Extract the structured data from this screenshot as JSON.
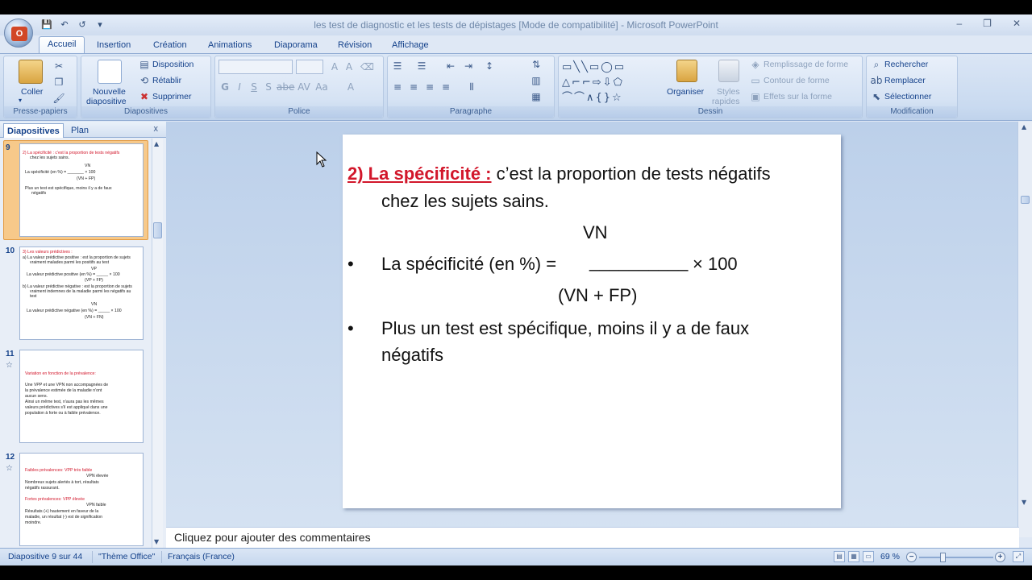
{
  "window": {
    "title": "les test de diagnostic et les tests de dépistages [Mode de compatibilité] - Microsoft PowerPoint",
    "controls": [
      "–",
      "❐",
      "✕"
    ]
  },
  "ribbon_tabs": [
    "Accueil",
    "Insertion",
    "Création",
    "Animations",
    "Diaporama",
    "Révision",
    "Affichage"
  ],
  "ribbon": {
    "clipboard": {
      "label": "Presse-papiers",
      "paste": "Coller"
    },
    "slides": {
      "label": "Diapositives",
      "new_slide_1": "Nouvelle",
      "new_slide_2": "diapositive",
      "layout": "Disposition",
      "reset": "Rétablir",
      "delete": "Supprimer"
    },
    "font": {
      "label": "Police"
    },
    "paragraph": {
      "label": "Paragraphe"
    },
    "drawing": {
      "label": "Dessin",
      "arrange": "Organiser",
      "quick_styles_1": "Styles",
      "quick_styles_2": "rapides",
      "fill": "Remplissage de forme",
      "outline": "Contour de forme",
      "effects": "Effets sur la forme"
    },
    "editing": {
      "label": "Modification",
      "find": "Rechercher",
      "replace": "Remplacer",
      "select": "Sélectionner"
    }
  },
  "left_panel": {
    "tab_slides": "Diapositives",
    "tab_outline": "Plan",
    "close": "x"
  },
  "thumbnails": [
    {
      "number": "9",
      "lines": [
        "2) La spécificité : c'est la proportion de tests négatifs",
        "chez les sujets sains.",
        "VN",
        "La spécificité (en %) = _______ × 100",
        "(VN + FP)",
        "Plus un test est spécifique, moins il y a de faux",
        "négatifs"
      ]
    },
    {
      "number": "10",
      "lines": [
        "3) Les valeurs prédictives :",
        "a) La valeur prédictive positive : est la proportion de sujets",
        "vraiment malades parmi les positifs au test",
        "VP",
        "La valeur prédictive positive (en %) = _____ × 100",
        "(VP + FP)",
        "b) La valeur prédictive négative : est la proportion de sujets",
        "vraiment indemnes de la maladie parmi les négatifs au",
        "test",
        "VN",
        "La valeur prédictive négative (en %) = _____ × 100",
        "(VN + FN)"
      ]
    },
    {
      "number": "11",
      "lines": [
        "Variation en fonction de la prévalence:",
        "Une VPP et une VPN non accompagnées de",
        "la prévalence estimée de la maladie n'ont",
        "aucun sens.",
        "Ainsi un même test, n'aura pas les mêmes",
        "valeurs prédictives s'il est appliqué dans une",
        "population à forte ou à faible prévalence."
      ]
    },
    {
      "number": "12",
      "lines": [
        "Faibles prévalences: VPP très faible",
        "VPN élevée",
        "Nombreux sujets alertés à tort, résultats",
        "négatifs rassurant.",
        "Fortes prévalences: VPP élevée",
        "VPN faible",
        "Résultats (+) hautement en faveur de la",
        "maladie, un résultat (-) est de signification",
        "moindre."
      ]
    }
  ],
  "slide": {
    "title": "2) La spécificité :",
    "line1": "c’est la proportion de tests négatifs",
    "line2": "chez les sujets sains.",
    "numerator": "VN",
    "formula": "La spécificité (en %) =",
    "blank": "__________",
    "times": "× 100",
    "denominator": "(VN + FP)",
    "bullet2_1": "Plus un test est spécifique, moins il y a de faux",
    "bullet2_2": "négatifs",
    "bullet": "•"
  },
  "notes": {
    "placeholder": "Cliquez pour ajouter des commentaires"
  },
  "status": {
    "slide": "Diapositive 9 sur 44",
    "theme": "\"Thème Office\"",
    "language": "Français (France)",
    "zoom": "69 %"
  },
  "colors": {
    "title_red": "#d2172b",
    "ribbon_text": "#15428b",
    "selected_thumb": "#f7c98a"
  }
}
